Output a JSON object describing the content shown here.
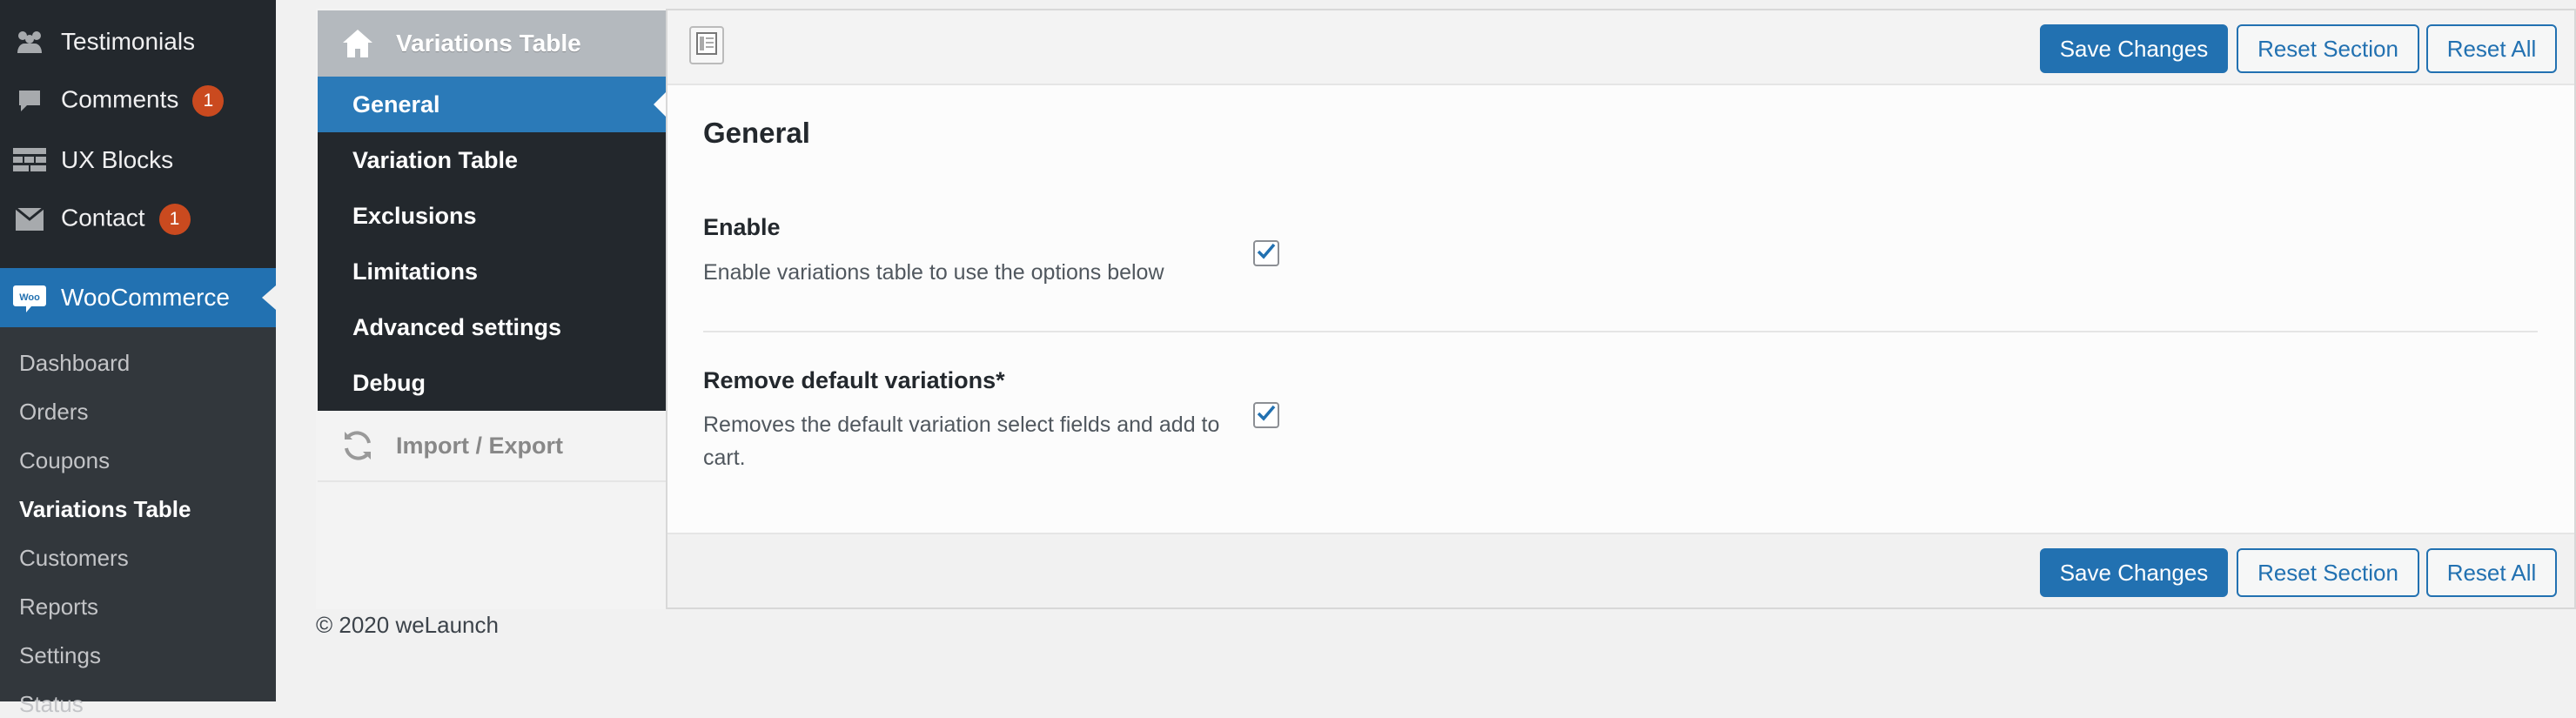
{
  "admin_menu": {
    "items": [
      {
        "label": "Testimonials",
        "icon": "testimonials-icon"
      },
      {
        "label": "Comments",
        "icon": "comments-icon",
        "badge": "1"
      },
      {
        "label": "UX Blocks",
        "icon": "blocks-icon"
      },
      {
        "label": "Contact",
        "icon": "envelope-icon",
        "badge": "1"
      }
    ],
    "woocommerce": {
      "label": "WooCommerce",
      "icon": "woocommerce-icon",
      "logo_text": "Woo"
    },
    "submenu": [
      "Dashboard",
      "Orders",
      "Coupons",
      "Variations Table",
      "Customers",
      "Reports",
      "Settings",
      "Status"
    ],
    "current_submenu": "Variations Table"
  },
  "options_sidebar": {
    "header": "Variations Table",
    "items": [
      "General",
      "Variation Table",
      "Exclusions",
      "Limitations",
      "Advanced settings",
      "Debug"
    ],
    "active": "General",
    "import_export": "Import / Export"
  },
  "toolbar": {
    "save": "Save Changes",
    "reset_section": "Reset Section",
    "reset_all": "Reset All"
  },
  "section": {
    "title": "General",
    "fields": [
      {
        "title": "Enable",
        "description": "Enable variations table to use the options below",
        "checked": true
      },
      {
        "title": "Remove default variations*",
        "description": "Removes the default variation select fields and add to cart.",
        "checked": true
      }
    ]
  },
  "footer": "© 2020 weLaunch",
  "colors": {
    "admin_bg": "#23282d",
    "submenu_bg": "#32373c",
    "accent": "#2271b1",
    "badge": "#ca4a1f",
    "active_item": "#2b7ab8"
  }
}
